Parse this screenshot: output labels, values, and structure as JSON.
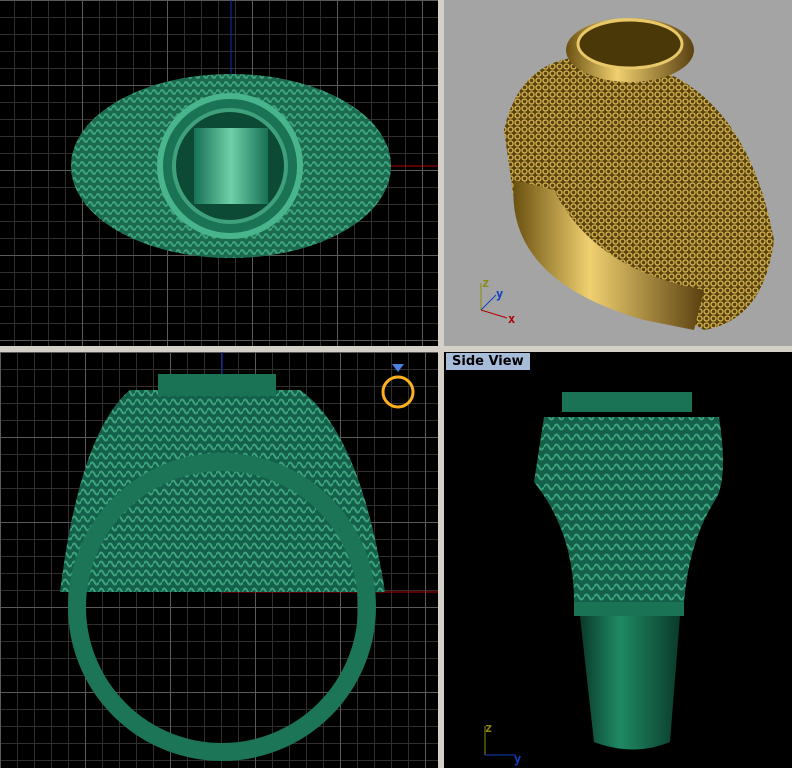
{
  "viewports": [
    {
      "name": "top",
      "label": ""
    },
    {
      "name": "perspective",
      "label": ""
    },
    {
      "name": "front",
      "label": ""
    },
    {
      "name": "side",
      "label": "Side View"
    }
  ],
  "axes": {
    "x": "x",
    "y": "y",
    "z": "z"
  },
  "colors": {
    "model_green": "#1f7a5a",
    "model_gold": "#b08a2a",
    "x_axis": "#b00000",
    "y_axis": "#1040c0",
    "z_axis": "#8a8a10",
    "viewport_label_bg": "#a6bcd8"
  }
}
